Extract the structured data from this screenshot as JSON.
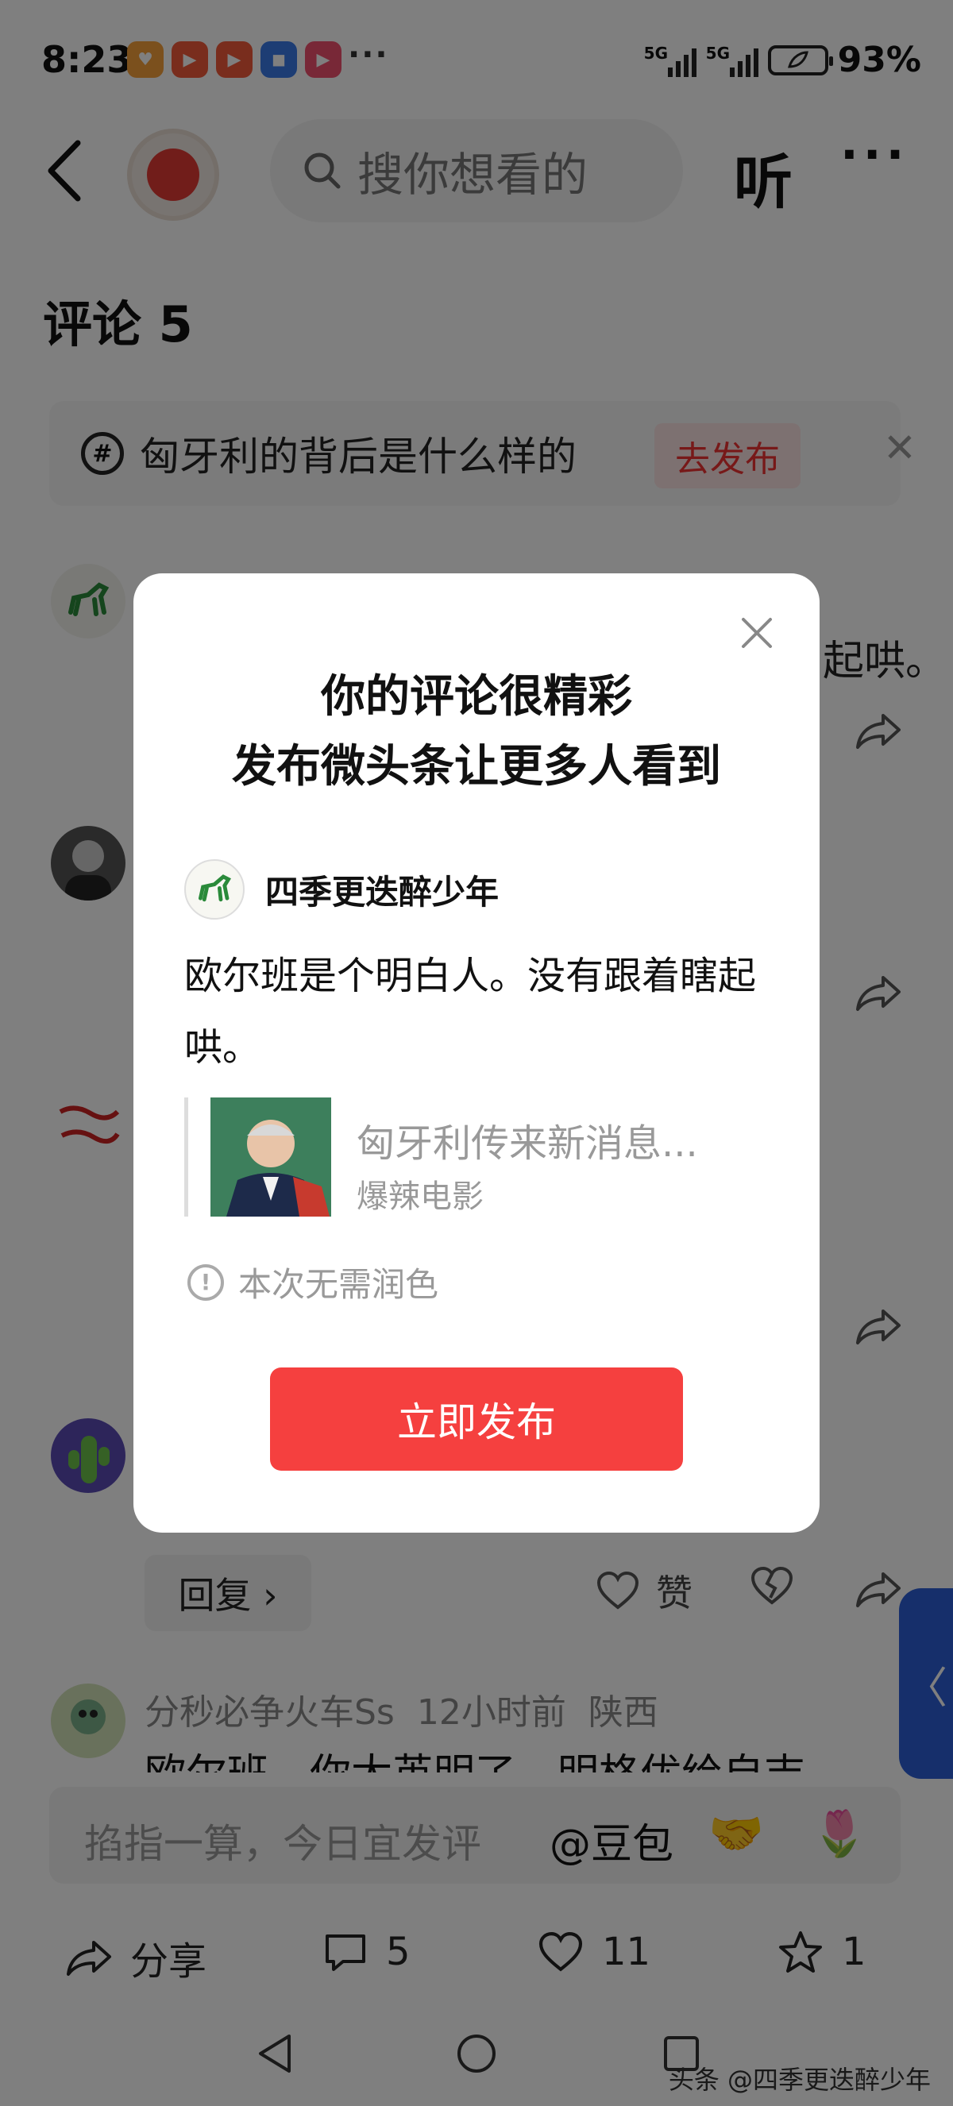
{
  "status_bar": {
    "time": "8:23",
    "app_icons": [
      {
        "name": "heart-app-icon",
        "color": "#f7a13b",
        "glyph": "♥"
      },
      {
        "name": "video-app-icon-1",
        "color": "#f25b3a",
        "glyph": "▶"
      },
      {
        "name": "video-app-icon-2",
        "color": "#f25b3a",
        "glyph": "▶"
      },
      {
        "name": "badge-app-icon",
        "color": "#3b7be8",
        "glyph": "◼"
      },
      {
        "name": "play-app-icon",
        "color": "#f0506e",
        "glyph": "▶"
      }
    ],
    "more_dots": "···",
    "network_1": "5G",
    "network_2": "5G",
    "battery_percent": "93%"
  },
  "top_bar": {
    "search_placeholder": "搜你想看的",
    "listen_label": "听",
    "more_label": "···"
  },
  "comments": {
    "title": "评论 5",
    "topic_text": "匈牙利的背后是什么样的",
    "topic_button": "去发布",
    "topic_close": "✕",
    "bg_fragment_1": "起哄。",
    "reply_label": "回复 ›",
    "like_label": "赞",
    "comment5": {
      "username": "分秒必争火车Ss",
      "time": "12小时前",
      "location": "陕西",
      "text": "欧尔班，你太英明了，明格优给自吉"
    }
  },
  "input_bar": {
    "placeholder": "掐指一算，今日宜发评",
    "at_label": "@豆包",
    "emoji_1": "🤝",
    "emoji_2": "🌷"
  },
  "bottom_bar": {
    "share_label": "分享",
    "comment_count": "5",
    "like_count": "11",
    "favorite_count": "1"
  },
  "side_tab": {
    "label": "〈"
  },
  "watermark": "头条 @四季更迭醉少年",
  "dialog": {
    "title_line1": "你的评论很精彩",
    "title_line2": "发布微头条让更多人看到",
    "username": "四季更迭醉少年",
    "body": "欧尔班是个明白人。没有跟着瞎起哄。",
    "quote_title": "匈牙利传来新消息...",
    "quote_source": "爆辣电影",
    "note": "本次无需润色",
    "publish_label": "立即发布"
  },
  "colors": {
    "accent_red": "#f5403f",
    "overlay": "rgba(0,0,0,0.50)",
    "side_tab_blue": "#2d5fd6"
  }
}
